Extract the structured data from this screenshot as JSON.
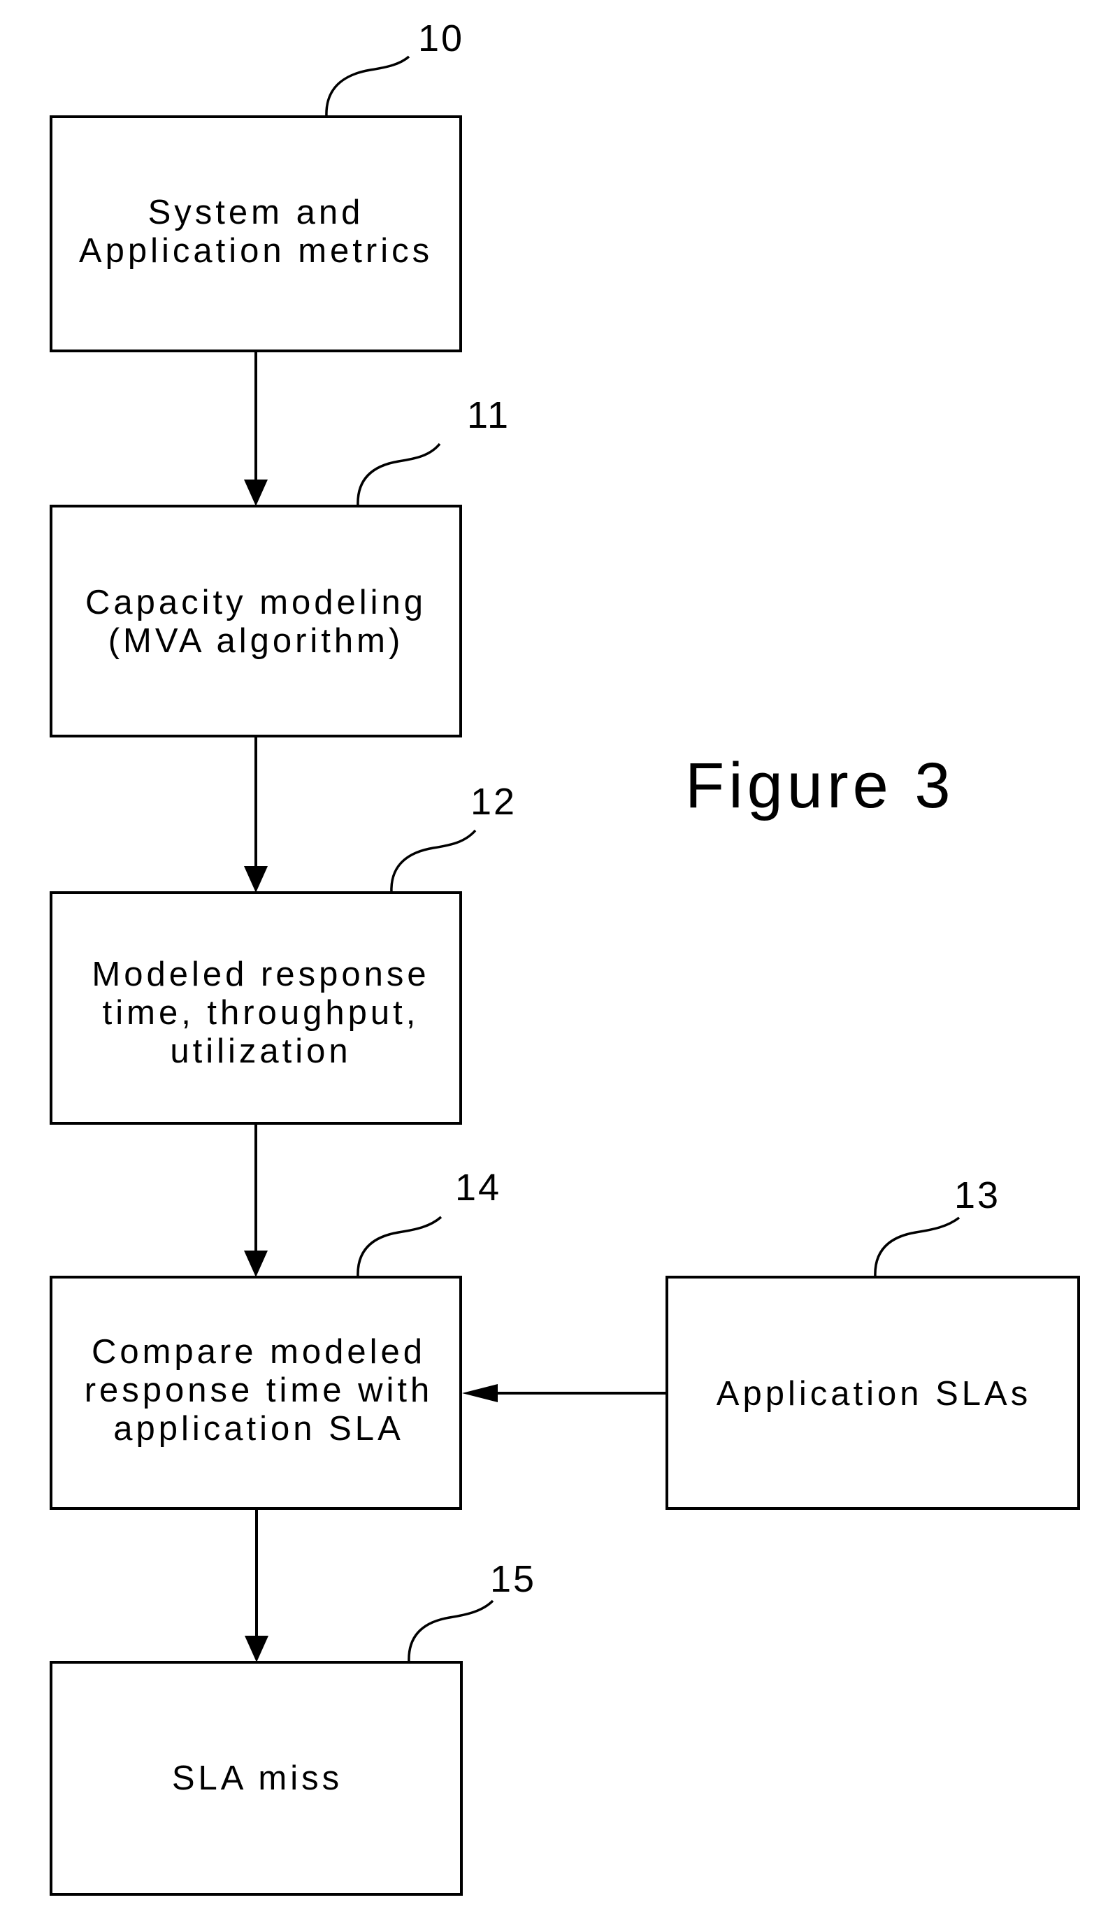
{
  "figure": {
    "title": "Figure 3"
  },
  "nodes": [
    {
      "id": "10",
      "ref": "10",
      "lines": [
        "System and",
        "Application metrics"
      ]
    },
    {
      "id": "11",
      "ref": "11",
      "lines": [
        "Capacity modeling",
        "(MVA algorithm)"
      ]
    },
    {
      "id": "12",
      "ref": "12",
      "lines": [
        "Modeled response",
        "time, throughput,",
        "utilization"
      ]
    },
    {
      "id": "14",
      "ref": "14",
      "lines": [
        "Compare modeled",
        "response time with",
        "application SLA"
      ]
    },
    {
      "id": "13",
      "ref": "13",
      "lines": [
        "Application SLAs"
      ]
    },
    {
      "id": "15",
      "ref": "15",
      "lines": [
        "SLA miss"
      ]
    }
  ],
  "edges": [
    {
      "from": "10",
      "to": "11"
    },
    {
      "from": "11",
      "to": "12"
    },
    {
      "from": "12",
      "to": "14"
    },
    {
      "from": "13",
      "to": "14"
    },
    {
      "from": "14",
      "to": "15"
    }
  ],
  "colors": {
    "stroke": "#000000",
    "background": "#ffffff"
  }
}
